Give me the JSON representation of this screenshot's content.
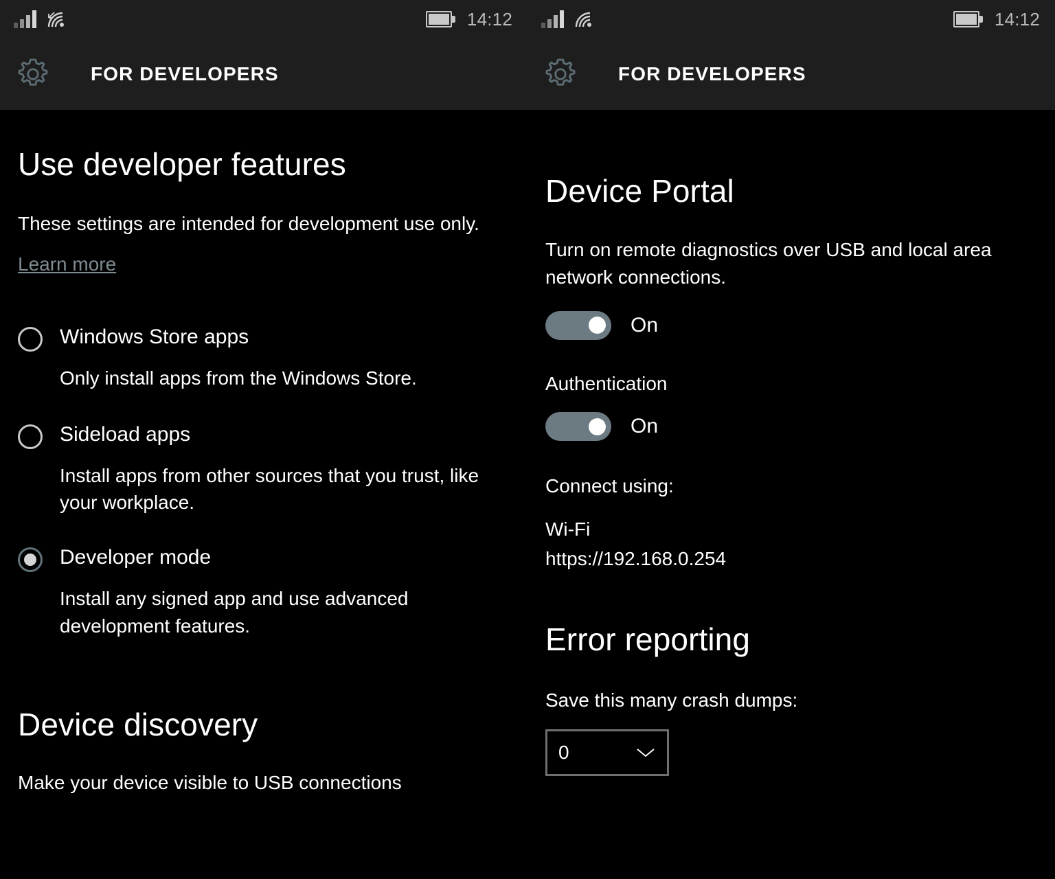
{
  "theme": {
    "background": "#000000",
    "header_background": "#1e1e1e",
    "text": "#ffffff",
    "muted_text": "#7e8b91",
    "status_icon": "#c9c9c9",
    "gear_icon": "#5d6d74",
    "toggle_on": "#6c7a82",
    "toggle_knob": "#ffffff",
    "radio_border": "#c8c8c8",
    "radio_checked_border": "#63737b",
    "radio_dot": "#d5d5d5",
    "dropdown_border": "#6f6f6f"
  },
  "left_panel": {
    "statusbar": {
      "signal_icon": "cellular-signal-icon",
      "wifi_icon": "wifi-icon-with-arrow",
      "battery_icon": "battery-icon",
      "time": "14:12"
    },
    "appbar": {
      "icon": "gear-icon",
      "title": "FOR DEVELOPERS"
    },
    "section_title": "Use developer features",
    "description": "These settings are intended for development use only.",
    "learn_more": "Learn more",
    "options": [
      {
        "label": "Windows Store apps",
        "description": "Only install apps from the Windows Store.",
        "selected": false
      },
      {
        "label": "Sideload apps",
        "description": "Install apps from other sources that you trust, like your workplace.",
        "selected": false
      },
      {
        "label": "Developer mode",
        "description": "Install any signed app and use advanced development features.",
        "selected": true
      }
    ],
    "device_discovery": {
      "title": "Device discovery",
      "description": "Make your device visible to USB connections"
    }
  },
  "right_panel": {
    "statusbar": {
      "signal_icon": "cellular-signal-icon",
      "wifi_icon": "wifi-icon",
      "battery_icon": "battery-icon",
      "time": "14:12"
    },
    "appbar": {
      "icon": "gear-icon",
      "title": "FOR DEVELOPERS"
    },
    "device_portal": {
      "title": "Device Portal",
      "description": "Turn on remote diagnostics over USB and local area network connections.",
      "toggle_state": "On",
      "authentication_label": "Authentication",
      "authentication_toggle_state": "On",
      "connect_using_label": "Connect using:",
      "connection_type": "Wi-Fi",
      "connection_url": "https://192.168.0.254"
    },
    "error_reporting": {
      "title": "Error reporting",
      "crash_dumps_label": "Save this many crash dumps:",
      "crash_dumps_value": "0",
      "chevron_icon": "chevron-down-icon"
    }
  }
}
